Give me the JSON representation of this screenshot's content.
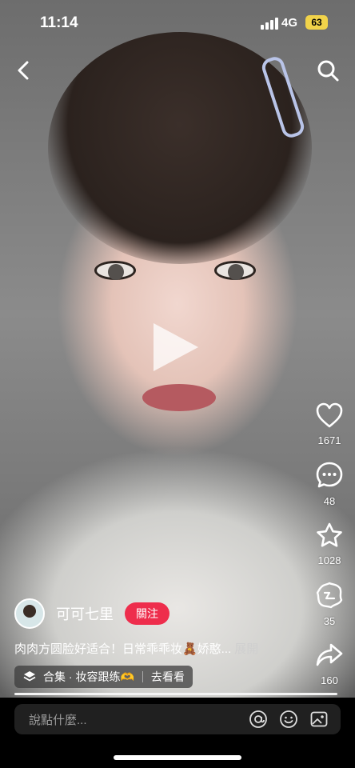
{
  "status_bar": {
    "time": "11:14",
    "network": "4G",
    "battery": "63"
  },
  "top_bar": {
    "back_icon": "chevron-left-icon",
    "search_icon": "search-icon"
  },
  "side_actions": [
    {
      "name": "like",
      "icon": "heart-icon",
      "count": "1671"
    },
    {
      "name": "comment",
      "icon": "comment-icon",
      "count": "48"
    },
    {
      "name": "favorite",
      "icon": "star-icon",
      "count": "1028"
    },
    {
      "name": "repost",
      "icon": "repost-icon",
      "count": "35"
    },
    {
      "name": "share",
      "icon": "share-icon",
      "count": "160"
    }
  ],
  "author": {
    "name": "可可七里",
    "follow_label": "關注"
  },
  "caption": {
    "text": "肉肉方圆脸好适合！日常乖乖妆🧸娇憨...",
    "more_label": "展開"
  },
  "collection": {
    "label": "合集 · 妆容跟练🫶",
    "action": "去看看"
  },
  "comment_bar": {
    "placeholder": "說點什麼..."
  },
  "colors": {
    "follow": "#ee2d4c",
    "battery": "#f1d34a"
  }
}
